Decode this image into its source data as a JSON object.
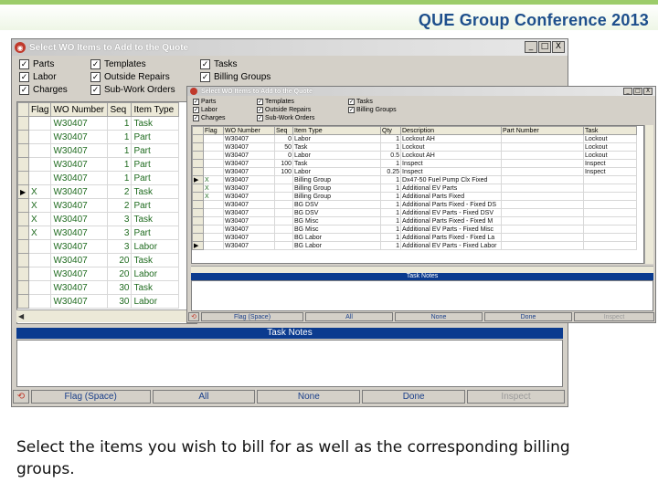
{
  "slide": {
    "title": "QUE Group Conference 2013",
    "caption": "Select the items you wish to bill for as well as the corresponding billing groups."
  },
  "main_window": {
    "title": "Select WO Items to Add to the Quote",
    "controls": [
      "_",
      "□",
      "X"
    ],
    "checkboxes": [
      {
        "label": "Parts",
        "checked": true
      },
      {
        "label": "Templates",
        "checked": true
      },
      {
        "label": "Tasks",
        "checked": true
      },
      {
        "label": "Labor",
        "checked": true
      },
      {
        "label": "Outside Repairs",
        "checked": true
      },
      {
        "label": "Billing Groups",
        "checked": true
      },
      {
        "label": "Charges",
        "checked": true
      },
      {
        "label": "Sub-Work Orders",
        "checked": true
      }
    ],
    "columns": [
      "Flag",
      "WO Number",
      "Seq",
      "Item Type"
    ],
    "rows": [
      {
        "marker": "",
        "flag": "",
        "wo": "W30407",
        "seq": "1",
        "type": "Task"
      },
      {
        "marker": "",
        "flag": "",
        "wo": "W30407",
        "seq": "1",
        "type": "Part"
      },
      {
        "marker": "",
        "flag": "",
        "wo": "W30407",
        "seq": "1",
        "type": "Part"
      },
      {
        "marker": "",
        "flag": "",
        "wo": "W30407",
        "seq": "1",
        "type": "Part"
      },
      {
        "marker": "",
        "flag": "",
        "wo": "W30407",
        "seq": "1",
        "type": "Part"
      },
      {
        "marker": "▶",
        "flag": "X",
        "wo": "W30407",
        "seq": "2",
        "type": "Task"
      },
      {
        "marker": "",
        "flag": "X",
        "wo": "W30407",
        "seq": "2",
        "type": "Part"
      },
      {
        "marker": "",
        "flag": "X",
        "wo": "W30407",
        "seq": "3",
        "type": "Task"
      },
      {
        "marker": "",
        "flag": "X",
        "wo": "W30407",
        "seq": "3",
        "type": "Part"
      },
      {
        "marker": "",
        "flag": "",
        "wo": "W30407",
        "seq": "3",
        "type": "Labor"
      },
      {
        "marker": "",
        "flag": "",
        "wo": "W30407",
        "seq": "20",
        "type": "Task"
      },
      {
        "marker": "",
        "flag": "",
        "wo": "W30407",
        "seq": "20",
        "type": "Labor"
      },
      {
        "marker": "",
        "flag": "",
        "wo": "W30407",
        "seq": "30",
        "type": "Task"
      },
      {
        "marker": "",
        "flag": "",
        "wo": "W30407",
        "seq": "30",
        "type": "Labor"
      }
    ],
    "task_notes_label": "Task Notes",
    "buttons": [
      {
        "label": "Flag (Space)",
        "enabled": true
      },
      {
        "label": "All",
        "enabled": true
      },
      {
        "label": "None",
        "enabled": true
      },
      {
        "label": "Done",
        "enabled": true
      },
      {
        "label": "Inspect",
        "enabled": false
      }
    ]
  },
  "second_window": {
    "title": "Select WO Items to Add to the Quote",
    "controls": [
      "_",
      "□",
      "X"
    ],
    "checkboxes": [
      {
        "label": "Parts",
        "checked": true
      },
      {
        "label": "Templates",
        "checked": true
      },
      {
        "label": "Tasks",
        "checked": true
      },
      {
        "label": "Labor",
        "checked": true
      },
      {
        "label": "Outside Repairs",
        "checked": true
      },
      {
        "label": "Billing Groups",
        "checked": true
      },
      {
        "label": "Charges",
        "checked": true
      },
      {
        "label": "Sub-Work Orders",
        "checked": true
      }
    ],
    "columns": [
      "Flag",
      "WO Number",
      "Seq",
      "Item Type",
      "Qty",
      "Description",
      "Part Number",
      "Task"
    ],
    "rows": [
      {
        "marker": "",
        "flag": "",
        "wo": "W30407",
        "seq": "0",
        "type": "Labor",
        "qty": "1",
        "desc": "Lockout AH",
        "part": "",
        "task": "Lockout"
      },
      {
        "marker": "",
        "flag": "",
        "wo": "W30407",
        "seq": "50",
        "type": "Task",
        "qty": "1",
        "desc": "Lockout",
        "part": "",
        "task": "Lockout"
      },
      {
        "marker": "",
        "flag": "",
        "wo": "W30407",
        "seq": "0",
        "type": "Labor",
        "qty": "0.5",
        "desc": "Lockout AH",
        "part": "",
        "task": "Lockout"
      },
      {
        "marker": "",
        "flag": "",
        "wo": "W30407",
        "seq": "100",
        "type": "Task",
        "qty": "1",
        "desc": "Inspect",
        "part": "",
        "task": "Inspect"
      },
      {
        "marker": "",
        "flag": "",
        "wo": "W30407",
        "seq": "100",
        "type": "Labor",
        "qty": "0.25",
        "desc": "Inspect",
        "part": "",
        "task": "Inspect"
      },
      {
        "marker": "▶",
        "flag": "X",
        "wo": "W30407",
        "seq": "",
        "type": "Billing Group",
        "qty": "1",
        "desc": "Dx47-50 Fuel Pump Clx Fixed",
        "part": "",
        "task": ""
      },
      {
        "marker": "",
        "flag": "X",
        "wo": "W30407",
        "seq": "",
        "type": "Billing Group",
        "qty": "1",
        "desc": "Additional EV Parts",
        "part": "",
        "task": ""
      },
      {
        "marker": "",
        "flag": "X",
        "wo": "W30407",
        "seq": "",
        "type": "Billing Group",
        "qty": "1",
        "desc": "Additional Parts Fixed",
        "part": "",
        "task": ""
      },
      {
        "marker": "",
        "flag": "",
        "wo": "W30407",
        "seq": "",
        "type": "BG DSV",
        "qty": "1",
        "desc": "Additional Parts Fixed - Fixed DS",
        "part": "",
        "task": ""
      },
      {
        "marker": "",
        "flag": "",
        "wo": "W30407",
        "seq": "",
        "type": "BG DSV",
        "qty": "1",
        "desc": "Additional EV Parts - Fixed DSV",
        "part": "",
        "task": ""
      },
      {
        "marker": "",
        "flag": "",
        "wo": "W30407",
        "seq": "",
        "type": "BG Misc",
        "qty": "1",
        "desc": "Additional Parts Fixed - Fixed M",
        "part": "",
        "task": ""
      },
      {
        "marker": "",
        "flag": "",
        "wo": "W30407",
        "seq": "",
        "type": "BG Misc",
        "qty": "1",
        "desc": "Additional EV Parts - Fixed Misc",
        "part": "",
        "task": ""
      },
      {
        "marker": "",
        "flag": "",
        "wo": "W30407",
        "seq": "",
        "type": "BG Labor",
        "qty": "1",
        "desc": "Additional Parts Fixed - Fixed La",
        "part": "",
        "task": ""
      },
      {
        "marker": "▶",
        "flag": "",
        "wo": "W30407",
        "seq": "",
        "type": "BG Labor",
        "qty": "1",
        "desc": "Additional EV Parts - Fixed Labor",
        "part": "",
        "task": ""
      }
    ],
    "task_notes_label": "Task Notes",
    "buttons": [
      {
        "label": "Flag (Space)",
        "enabled": true
      },
      {
        "label": "All",
        "enabled": true
      },
      {
        "label": "None",
        "enabled": true
      },
      {
        "label": "Done",
        "enabled": true
      },
      {
        "label": "Inspect",
        "enabled": false
      }
    ]
  },
  "colors": {
    "accent_green": "#9ccc6a",
    "title_blue": "#1e4f8c",
    "notes_bar": "#0b3b8f",
    "row_text": "#1f6b1f"
  }
}
